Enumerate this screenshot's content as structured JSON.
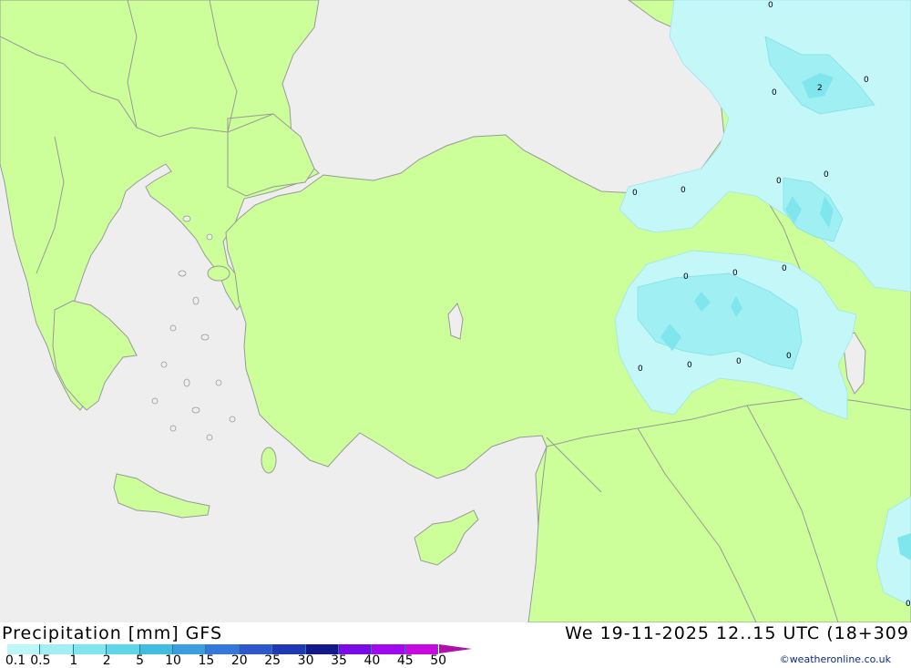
{
  "legend": {
    "title": "Precipitation [mm] GFS",
    "datetime": "We 19-11-2025 12..15 UTC (18+309",
    "ticks": [
      "0.1",
      "0.5",
      "1",
      "2",
      "5",
      "10",
      "15",
      "20",
      "25",
      "30",
      "35",
      "40",
      "45",
      "50"
    ],
    "colors": [
      "#bdf6f6",
      "#a0f0f3",
      "#7fe6ee",
      "#5ed6e6",
      "#40bde0",
      "#3a9ee0",
      "#3578dc",
      "#2c58cc",
      "#1f38b4",
      "#14188c",
      "#7a0ae8",
      "#a00aee",
      "#c80ae0",
      "#e40ad0",
      "#b010a8"
    ],
    "credit": "©weatheronline.co.uk"
  },
  "map": {
    "sea_color": "#eeeeee",
    "land_color": "#ccff99",
    "border_color": "#999999",
    "precip_labels": [
      "0",
      "2",
      "0",
      "0",
      "0",
      "0",
      "0",
      "0",
      "0",
      "0",
      "0",
      "0",
      "0",
      "0",
      "0",
      "0"
    ]
  }
}
